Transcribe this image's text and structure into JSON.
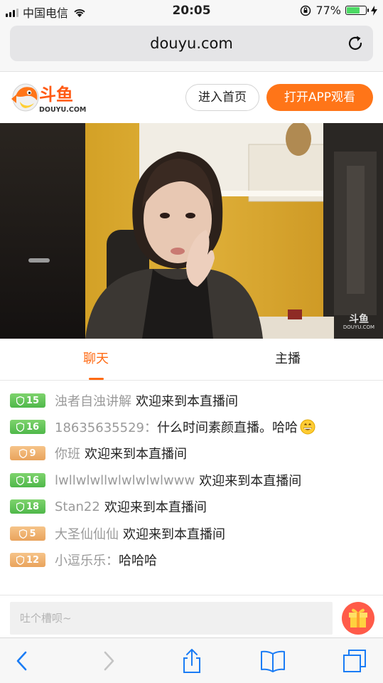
{
  "status_bar": {
    "carrier": "中国电信",
    "time": "20:05",
    "battery": "77%",
    "battery_level": 0.77
  },
  "browser": {
    "url": "douyu.com"
  },
  "site_header": {
    "logo_text": "斗鱼",
    "logo_sub": "DOUYU.COM",
    "home_button": "进入首页",
    "app_button": "打开APP观看"
  },
  "video": {
    "watermark_text": "斗鱼",
    "watermark_sub": "DOUYU.COM"
  },
  "tabs": [
    {
      "label": "聊天",
      "active": true
    },
    {
      "label": "主播",
      "active": false
    }
  ],
  "chat": {
    "messages": [
      {
        "level": "15",
        "badge_color": "#5cc457",
        "name": "浊者自浊讲解",
        "text": "欢迎来到本直播间"
      },
      {
        "level": "16",
        "badge_color": "#5cc457",
        "name": "18635635529：",
        "text": "什么时间素颜直播。哈哈",
        "emoji": "grinning-face-emoji"
      },
      {
        "level": "9",
        "badge_color": "#eeac68",
        "name": "你班",
        "text": "欢迎来到本直播间"
      },
      {
        "level": "16",
        "badge_color": "#5cc457",
        "name": "lwllwlwllwlwlwlwlwww",
        "text": "欢迎来到本直播间"
      },
      {
        "level": "18",
        "badge_color": "#5cc457",
        "name": "Stan22",
        "text": "欢迎来到本直播间"
      },
      {
        "level": "5",
        "badge_color": "#eeac68",
        "name": "大圣仙仙仙",
        "text": "欢迎来到本直播间"
      },
      {
        "level": "12",
        "badge_color": "#eeac68",
        "name": "小逗乐乐：",
        "text": "哈哈哈"
      }
    ]
  },
  "input": {
    "placeholder": "吐个槽呗~",
    "gift_icon": "gift-icon"
  },
  "colors": {
    "accent": "#ff6a13",
    "app_button": "#ff7518",
    "level_green": "#5cc457",
    "level_orange": "#eeac68"
  }
}
